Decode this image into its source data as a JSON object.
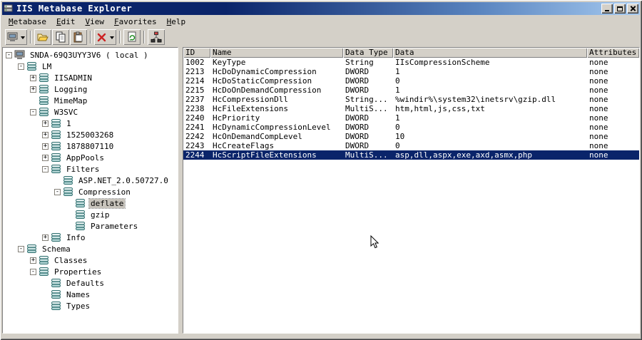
{
  "window": {
    "title": "IIS Metabase Explorer",
    "icon": "metabase-app-icon",
    "controls": [
      "minimize-button",
      "maximize-button",
      "close-button"
    ]
  },
  "menu": {
    "items": [
      "Metabase",
      "Edit",
      "View",
      "Favorites",
      "Help"
    ]
  },
  "toolbar": {
    "items": [
      {
        "type": "button",
        "icon": "connect-computer-icon",
        "dropdown": true
      },
      {
        "type": "separator"
      },
      {
        "type": "button",
        "icon": "open-folder-icon"
      },
      {
        "type": "button",
        "icon": "copy-icon"
      },
      {
        "type": "button",
        "icon": "paste-icon"
      },
      {
        "type": "separator"
      },
      {
        "type": "button",
        "icon": "delete-icon",
        "dropdown": true
      },
      {
        "type": "separator"
      },
      {
        "type": "button",
        "icon": "refresh-page-icon"
      },
      {
        "type": "separator"
      },
      {
        "type": "button",
        "icon": "network-nodes-icon"
      }
    ]
  },
  "tree": {
    "nodes": [
      {
        "label": "SNDA-69Q3UYY3V6 ( local )",
        "level": 0,
        "expander": "minus",
        "icon": "computer-icon",
        "selected": false
      },
      {
        "label": "LM",
        "level": 1,
        "expander": "minus",
        "icon": "database-icon",
        "selected": false
      },
      {
        "label": "IISADMIN",
        "level": 2,
        "expander": "plus",
        "icon": "database-icon",
        "selected": false
      },
      {
        "label": "Logging",
        "level": 2,
        "expander": "plus",
        "icon": "database-icon",
        "selected": false
      },
      {
        "label": "MimeMap",
        "level": 2,
        "expander": "none",
        "icon": "database-icon",
        "selected": false
      },
      {
        "label": "W3SVC",
        "level": 2,
        "expander": "minus",
        "icon": "database-icon",
        "selected": false
      },
      {
        "label": "1",
        "level": 3,
        "expander": "plus",
        "icon": "database-icon",
        "selected": false
      },
      {
        "label": "1525003268",
        "level": 3,
        "expander": "plus",
        "icon": "database-icon",
        "selected": false
      },
      {
        "label": "1878807110",
        "level": 3,
        "expander": "plus",
        "icon": "database-icon",
        "selected": false
      },
      {
        "label": "AppPools",
        "level": 3,
        "expander": "plus",
        "icon": "database-icon",
        "selected": false
      },
      {
        "label": "Filters",
        "level": 3,
        "expander": "minus",
        "icon": "database-icon",
        "selected": false
      },
      {
        "label": "ASP.NET_2.0.50727.0",
        "level": 4,
        "expander": "none",
        "icon": "database-icon",
        "selected": false
      },
      {
        "label": "Compression",
        "level": 4,
        "expander": "minus",
        "icon": "database-icon",
        "selected": false
      },
      {
        "label": "deflate",
        "level": 5,
        "expander": "none",
        "icon": "database-icon",
        "selected": true
      },
      {
        "label": "gzip",
        "level": 5,
        "expander": "none",
        "icon": "database-icon",
        "selected": false
      },
      {
        "label": "Parameters",
        "level": 5,
        "expander": "none",
        "icon": "database-icon",
        "selected": false
      },
      {
        "label": "Info",
        "level": 3,
        "expander": "plus",
        "icon": "database-icon",
        "selected": false
      },
      {
        "label": "Schema",
        "level": 1,
        "expander": "minus",
        "icon": "database-icon",
        "selected": false
      },
      {
        "label": "Classes",
        "level": 2,
        "expander": "plus",
        "icon": "database-icon",
        "selected": false
      },
      {
        "label": "Properties",
        "level": 2,
        "expander": "minus",
        "icon": "database-icon",
        "selected": false
      },
      {
        "label": "Defaults",
        "level": 3,
        "expander": "none",
        "icon": "database-icon",
        "selected": false
      },
      {
        "label": "Names",
        "level": 3,
        "expander": "none",
        "icon": "database-icon",
        "selected": false
      },
      {
        "label": "Types",
        "level": 3,
        "expander": "none",
        "icon": "database-icon",
        "selected": false
      }
    ]
  },
  "table": {
    "columns": [
      "ID",
      "Name",
      "Data Type",
      "Data",
      "Attributes"
    ],
    "selected_row_index": 10,
    "rows": [
      [
        "1002",
        "KeyType",
        "String",
        "IIsCompressionScheme",
        "none"
      ],
      [
        "2213",
        "HcDoDynamicCompression",
        "DWORD",
        "1",
        "none"
      ],
      [
        "2214",
        "HcDoStaticCompression",
        "DWORD",
        "0",
        "none"
      ],
      [
        "2215",
        "HcDoOnDemandCompression",
        "DWORD",
        "1",
        "none"
      ],
      [
        "2237",
        "HcCompressionDll",
        "String...",
        "%windir%\\system32\\inetsrv\\gzip.dll",
        "none"
      ],
      [
        "2238",
        "HcFileExtensions",
        "MultiS...",
        "htm,html,js,css,txt",
        "none"
      ],
      [
        "2240",
        "HcPriority",
        "DWORD",
        "1",
        "none"
      ],
      [
        "2241",
        "HcDynamicCompressionLevel",
        "DWORD",
        "0",
        "none"
      ],
      [
        "2242",
        "HcOnDemandCompLevel",
        "DWORD",
        "10",
        "none"
      ],
      [
        "2243",
        "HcCreateFlags",
        "DWORD",
        "0",
        "none"
      ],
      [
        "2244",
        "HcScriptFileExtensions",
        "MultiS...",
        "asp,dll,aspx,exe,axd,asmx,php",
        "none"
      ]
    ]
  },
  "colors": {
    "chrome": "#d4d0c8",
    "titlebar_start": "#0a246a",
    "titlebar_end": "#a6caf0",
    "selection": "#0a246a",
    "inactive_selection": "#c8c4bc"
  }
}
